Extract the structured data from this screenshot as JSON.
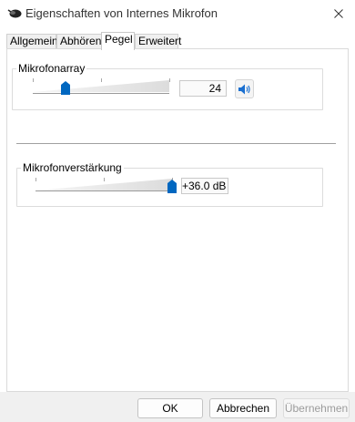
{
  "window": {
    "title": "Eigenschaften von Internes Mikrofon"
  },
  "tabs": [
    {
      "label": "Allgemein",
      "active": false
    },
    {
      "label": "Abhören",
      "active": false
    },
    {
      "label": "Pegel",
      "active": true
    },
    {
      "label": "Erweitert",
      "active": false
    }
  ],
  "level": {
    "group_label": "Mikrofonarray",
    "value": "24",
    "slider_fraction": 0.24,
    "speaker_icon": "speaker-volume-icon"
  },
  "boost": {
    "group_label": "Mikrofonverstärkung",
    "value": "+36.0 dB",
    "slider_fraction": 1.0
  },
  "buttons": {
    "ok": "OK",
    "cancel": "Abbrechen",
    "apply": "Übernehmen"
  },
  "colors": {
    "accent": "#0067c0"
  }
}
